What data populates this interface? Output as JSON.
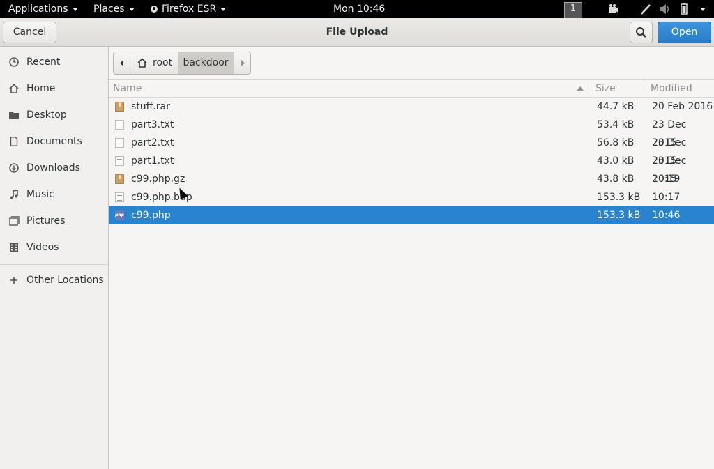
{
  "topbar": {
    "applications": "Applications",
    "places": "Places",
    "firefox": "Firefox ESR",
    "clock": "Mon 10:46",
    "workspace": "1"
  },
  "dialog": {
    "title": "File Upload",
    "cancel": "Cancel",
    "open": "Open"
  },
  "sidebar": {
    "items": [
      {
        "label": "Recent",
        "icon": "clock-icon"
      },
      {
        "label": "Home",
        "icon": "home-icon"
      },
      {
        "label": "Desktop",
        "icon": "folder-icon"
      },
      {
        "label": "Documents",
        "icon": "document-icon"
      },
      {
        "label": "Downloads",
        "icon": "download-icon"
      },
      {
        "label": "Music",
        "icon": "music-icon"
      },
      {
        "label": "Pictures",
        "icon": "pictures-icon"
      },
      {
        "label": "Videos",
        "icon": "video-icon"
      }
    ],
    "other_locations": "Other Locations"
  },
  "pathbar": {
    "root": "root",
    "current": "backdoor"
  },
  "filelist": {
    "columns": {
      "name": "Name",
      "size": "Size",
      "modified": "Modified"
    },
    "files": [
      {
        "name": "stuff.rar",
        "size": "44.7 kB",
        "modified": "20 Feb 2016",
        "icon": "archive-icon"
      },
      {
        "name": "part3.txt",
        "size": "53.4 kB",
        "modified": "23 Dec 2015",
        "icon": "text-file-icon"
      },
      {
        "name": "part2.txt",
        "size": "56.8 kB",
        "modified": "23 Dec 2015",
        "icon": "text-file-icon"
      },
      {
        "name": "part1.txt",
        "size": "43.0 kB",
        "modified": "23 Dec 2015",
        "icon": "text-file-icon"
      },
      {
        "name": "c99.php.gz",
        "size": "43.8 kB",
        "modified": "10:19",
        "icon": "archive-icon"
      },
      {
        "name": "c99.php.bup",
        "size": "153.3 kB",
        "modified": "10:17",
        "icon": "text-file-icon"
      },
      {
        "name": "c99.php",
        "size": "153.3 kB",
        "modified": "10:46",
        "icon": "php-file-icon",
        "selected": true
      }
    ]
  },
  "colors": {
    "accent": "#2a83cf",
    "topbar": "#000000"
  }
}
